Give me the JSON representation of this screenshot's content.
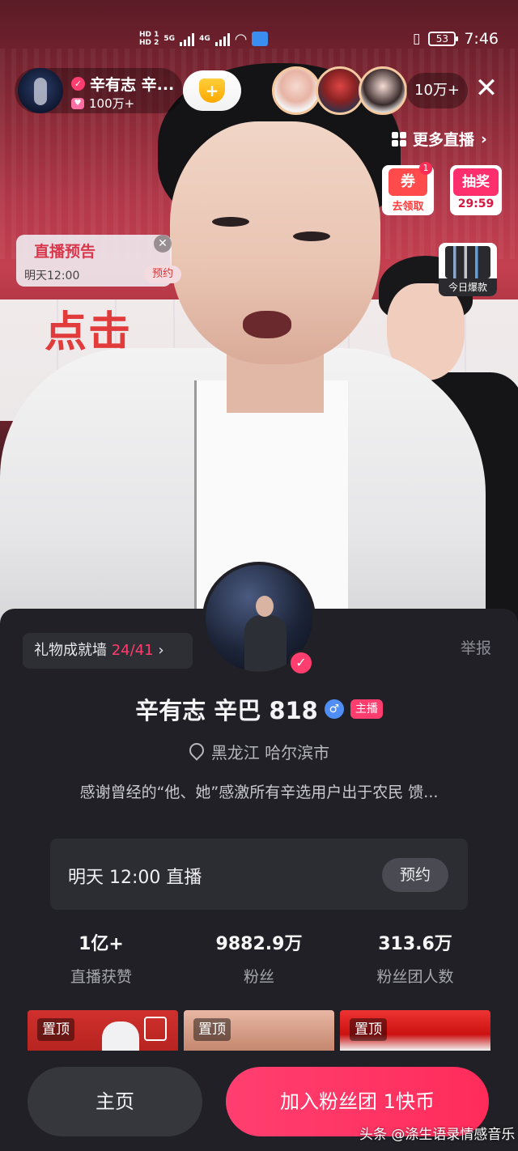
{
  "status_bar": {
    "sim1": "HD 1",
    "sim2": "HD 2",
    "net1": "5G",
    "net2": "4G",
    "battery": "53",
    "time": "7:46"
  },
  "host": {
    "name_short": "辛有志 辛...",
    "likes": "100万+"
  },
  "viewers": {
    "count": "10万+"
  },
  "more_live": {
    "label": "更多直播"
  },
  "coupon": {
    "icon_text": "券",
    "badge": "1",
    "label": "去领取"
  },
  "lottery": {
    "icon_text": "抽奖",
    "countdown": "29:59"
  },
  "live_preview": {
    "title": "直播预告",
    "time": "明天12:00",
    "reserve": "预约"
  },
  "hot_item": {
    "label": "今日爆款"
  },
  "backdrop": {
    "banner_text": "点击"
  },
  "profile": {
    "gift_wall_label": "礼物成就墙 ",
    "gift_wall_count": "24/41",
    "report": "举报",
    "name": "辛有志 辛巴 818",
    "gender_symbol": "♂",
    "host_tag": "主播",
    "location": "黑龙江 哈尔滨市",
    "bio": "感谢曾经的“他、她”感激所有辛选用户出于农民 馈...",
    "schedule_text": "明天 12:00 直播",
    "schedule_button": "预约"
  },
  "stats": [
    {
      "value": "1亿+",
      "label": "直播获赞"
    },
    {
      "value": "9882.9万",
      "label": "粉丝"
    },
    {
      "value": "313.6万",
      "label": "粉丝团人数"
    }
  ],
  "pinned_videos": [
    {
      "tag": "置顶"
    },
    {
      "tag": "置顶"
    },
    {
      "tag": "置顶"
    }
  ],
  "bottom": {
    "home_button": "主页",
    "join_button": "加入粉丝团 1快币"
  },
  "watermark": "头条 @涤生语录情感音乐",
  "colors": {
    "accent": "#ff3d6e",
    "panel_bg": "#202026"
  }
}
